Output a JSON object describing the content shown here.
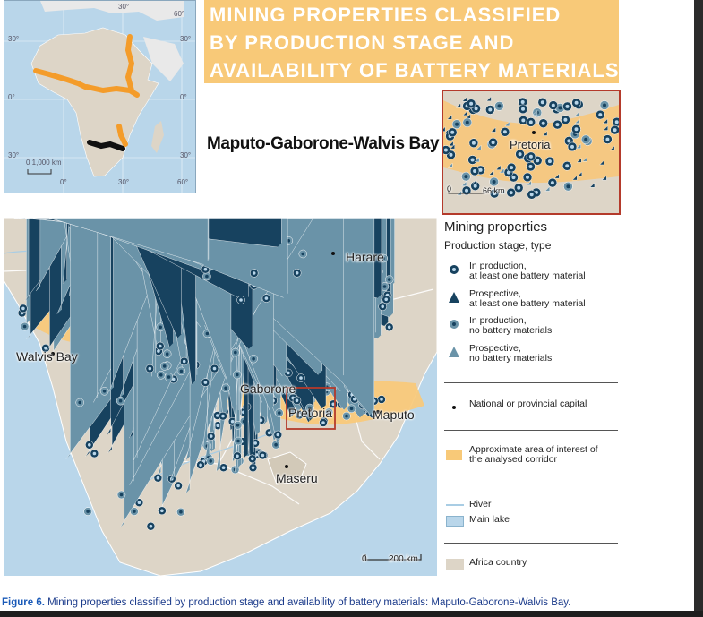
{
  "title": {
    "line1": "MINING PROPERTIES CLASSIFIED",
    "line2": "BY PRODUCTION STAGE AND",
    "line3": "AVAILABILITY OF BATTERY MATERIALS"
  },
  "subtitle": "Maputo-Gaborone-Walvis Bay",
  "inset_map": {
    "lat_labels": [
      "30°",
      "0°",
      "30°"
    ],
    "lon_labels": [
      "0°",
      "30°",
      "60°"
    ],
    "top_labels": [
      "30°",
      "60°"
    ],
    "scale_label": "0  1,000  km"
  },
  "zoom_map": {
    "city": "Pretoria",
    "scale_label": "0",
    "scale_km": "66 km"
  },
  "main_map": {
    "cities": {
      "harare": "Harare",
      "walvis_bay": "Walvis Bay",
      "gaborone": "Gaborone",
      "pretoria": "Pretoria",
      "maputo": "Maputo",
      "maseru": "Maseru"
    },
    "scale_zero": "0",
    "scale_km": "200  km"
  },
  "legend": {
    "title": "Mining properties",
    "subtitle": "Production stage, type",
    "items": {
      "in_prod_battery": [
        "In production,",
        "at least one battery material"
      ],
      "prosp_battery": [
        "Prospective,",
        "at least one battery material"
      ],
      "in_prod_none": [
        "In production,",
        "no battery materials"
      ],
      "prosp_none": [
        "Prospective,",
        "no battery materials"
      ],
      "capital": "National or provincial capital",
      "corridor": [
        "Approximate area of interest of",
        "the analysed corridor"
      ],
      "river": "River",
      "lake": "Main lake",
      "country": "Africa country"
    }
  },
  "caption": {
    "label": "Figure 6.",
    "text": " Mining properties classified by production stage and availability of battery materials: Maputo-Gaborone-Walvis Bay."
  },
  "colors": {
    "corridor": "#f8c978",
    "land": "#ddd5c7",
    "sea": "#b9d6ea",
    "dark_symbol": "#17425f",
    "light_symbol": "#6a93a8",
    "frame": "#b43a2b"
  }
}
